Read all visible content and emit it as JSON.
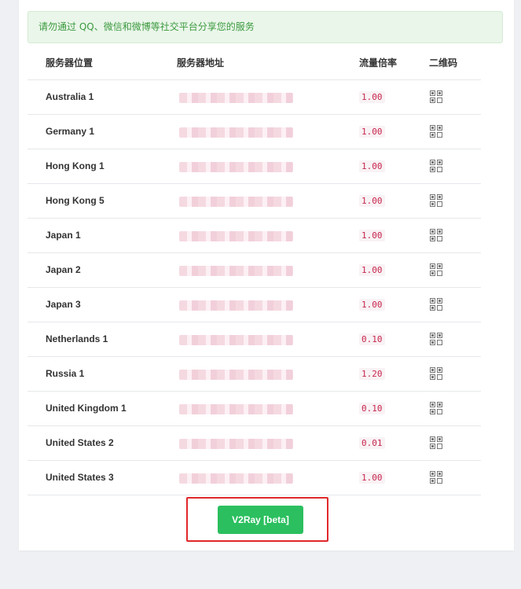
{
  "notice": "请勿通过 QQ、微信和微博等社交平台分享您的服务",
  "table": {
    "headers": {
      "location": "服务器位置",
      "address": "服务器地址",
      "rate": "流量倍率",
      "qr": "二维码"
    },
    "rows": [
      {
        "location": "Australia 1",
        "rate": "1.00"
      },
      {
        "location": "Germany 1",
        "rate": "1.00"
      },
      {
        "location": "Hong Kong 1",
        "rate": "1.00"
      },
      {
        "location": "Hong Kong 5",
        "rate": "1.00"
      },
      {
        "location": "Japan 1",
        "rate": "1.00"
      },
      {
        "location": "Japan 2",
        "rate": "1.00"
      },
      {
        "location": "Japan 3",
        "rate": "1.00"
      },
      {
        "location": "Netherlands 1",
        "rate": "0.10"
      },
      {
        "location": "Russia 1",
        "rate": "1.20"
      },
      {
        "location": "United Kingdom 1",
        "rate": "0.10"
      },
      {
        "location": "United States 2",
        "rate": "0.01"
      },
      {
        "location": "United States 3",
        "rate": "1.00"
      }
    ]
  },
  "button": {
    "label": "V2Ray [beta]"
  },
  "colors": {
    "accent_green": "#2bbf5f",
    "rate_text": "#c7254e",
    "highlight_border": "#e0282b"
  },
  "icons": {
    "qr": "qr-code-icon"
  }
}
